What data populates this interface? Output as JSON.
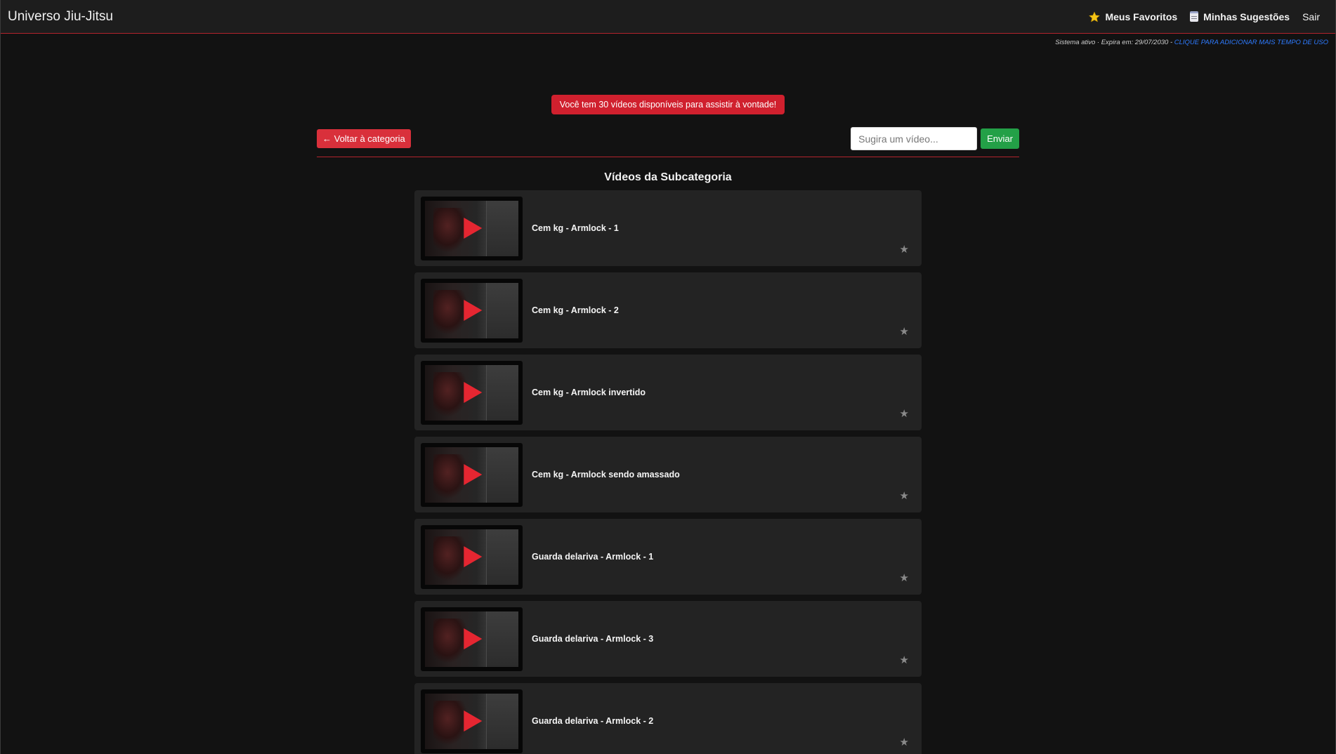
{
  "navbar": {
    "brand": "Universo Jiu-Jitsu",
    "favorites_label": "Meus Favoritos",
    "suggestions_label": "Minhas Sugestões",
    "logout_label": "Sair"
  },
  "status": {
    "text": "Sistema ativo · Expira em: 29/07/2030 - ",
    "link_text": "Clique para adicionar mais tempo de uso"
  },
  "alert": {
    "text": "Você tem 30 vídeos disponíveis para assistir à vontade!"
  },
  "toolbar": {
    "back_label": "← Voltar à categoria",
    "suggest_placeholder": "Sugira um vídeo...",
    "send_label": "Enviar"
  },
  "section_title": "Vídeos da Subcategoria",
  "videos": [
    {
      "title": "Cem kg - Armlock - 1"
    },
    {
      "title": "Cem kg - Armlock - 2"
    },
    {
      "title": "Cem kg - Armlock invertido"
    },
    {
      "title": "Cem kg - Armlock sendo amassado"
    },
    {
      "title": "Guarda delariva - Armlock - 1"
    },
    {
      "title": "Guarda delariva - Armlock - 3"
    },
    {
      "title": "Guarda delariva - Armlock - 2"
    }
  ],
  "colors": {
    "accent_red": "#d0202e",
    "send_green": "#23a047",
    "link_blue": "#2e7bff"
  },
  "icons": {
    "favorites": "star-icon",
    "suggestions": "memo-icon",
    "video_favorite": "star-icon",
    "thumbnail": "play-icon"
  }
}
